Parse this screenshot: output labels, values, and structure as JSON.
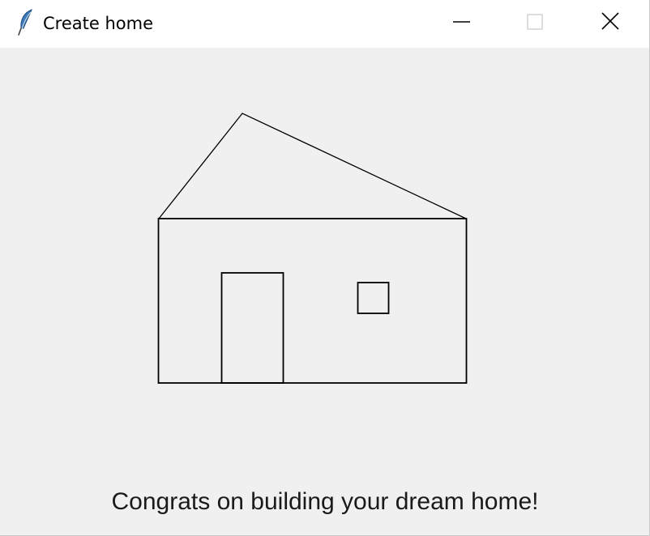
{
  "window": {
    "title": "Create home",
    "icon": "feather-icon",
    "controls": [
      "minimize-icon",
      "maximize-icon",
      "close-icon"
    ]
  },
  "canvas": {
    "background": "#f0f0f0",
    "stroke_color": "#000000",
    "message": "Congrats on building your dream home!"
  }
}
